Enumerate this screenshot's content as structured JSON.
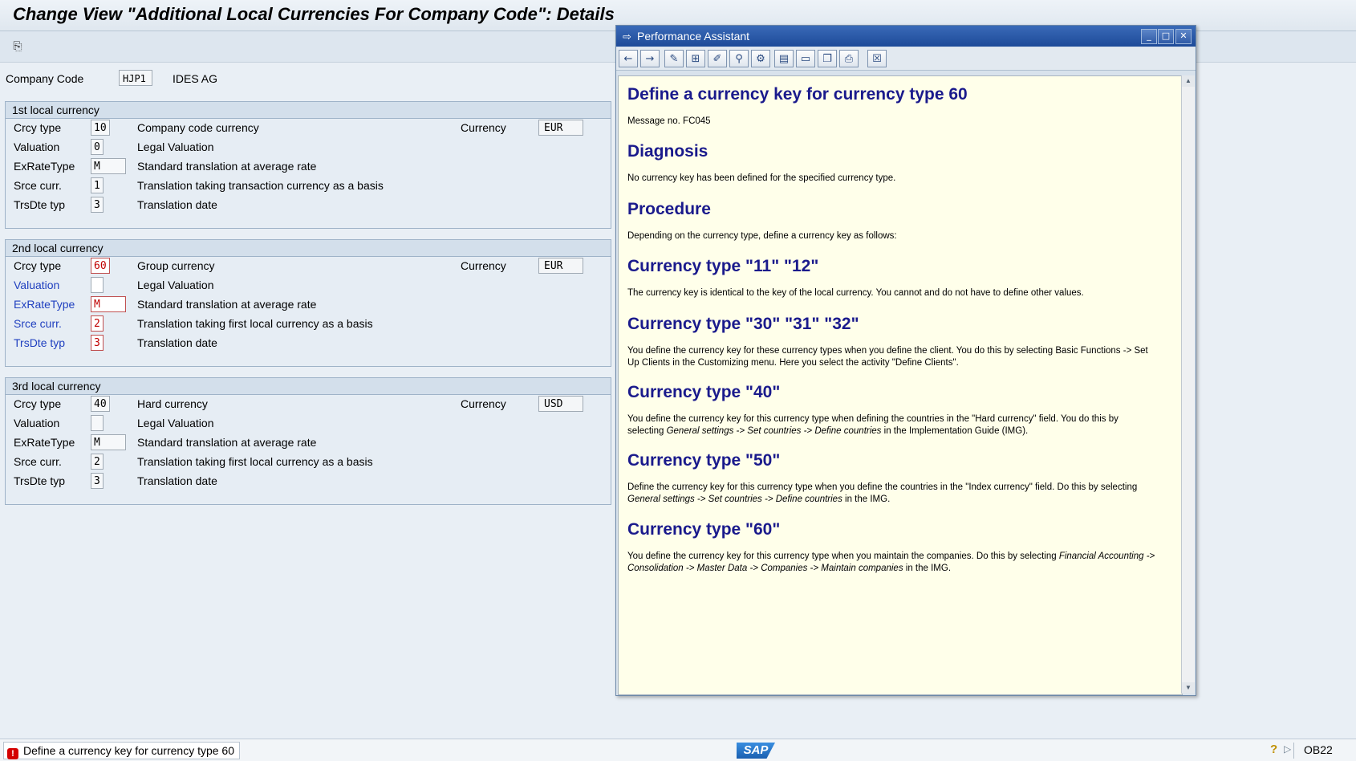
{
  "window": {
    "title": "Change View \"Additional Local Currencies For Company Code\": Details"
  },
  "company": {
    "label": "Company Code",
    "code": "HJP1",
    "name": "IDES AG"
  },
  "groups": [
    {
      "title": "1st local currency",
      "rows": [
        {
          "label": "Crcy type",
          "value": "10",
          "desc": "Company code currency",
          "currency_label": "Currency",
          "currency": "EUR"
        },
        {
          "label": "Valuation",
          "value": "0",
          "desc": "Legal Valuation"
        },
        {
          "label": "ExRateType",
          "value": "M",
          "desc": "Standard translation at average rate"
        },
        {
          "label": "Srce curr.",
          "value": "1",
          "desc": "Translation taking transaction currency as a basis"
        },
        {
          "label": "TrsDte typ",
          "value": "3",
          "desc": "Translation date"
        }
      ]
    },
    {
      "title": "2nd local currency",
      "rows": [
        {
          "label": "Crcy type",
          "value": "60",
          "desc": "Group currency",
          "currency_label": "Currency",
          "currency": "EUR"
        },
        {
          "label": "Valuation",
          "value": "",
          "desc": "Legal Valuation"
        },
        {
          "label": "ExRateType",
          "value": "M",
          "desc": "Standard translation at average rate"
        },
        {
          "label": "Srce curr.",
          "value": "2",
          "desc": "Translation taking first local currency as a basis"
        },
        {
          "label": "TrsDte typ",
          "value": "3",
          "desc": "Translation date"
        }
      ]
    },
    {
      "title": "3rd local currency",
      "rows": [
        {
          "label": "Crcy type",
          "value": "40",
          "desc": "Hard currency",
          "currency_label": "Currency",
          "currency": "USD"
        },
        {
          "label": "Valuation",
          "value": "",
          "desc": "Legal Valuation"
        },
        {
          "label": "ExRateType",
          "value": "M",
          "desc": "Standard translation at average rate"
        },
        {
          "label": "Srce curr.",
          "value": "2",
          "desc": "Translation taking first local currency as a basis"
        },
        {
          "label": "TrsDte typ",
          "value": "3",
          "desc": "Translation date"
        }
      ]
    }
  ],
  "status": {
    "message": "Define a currency key for currency type 60",
    "tcode": "OB22",
    "logo": "SAP"
  },
  "assistant": {
    "title": "Performance Assistant",
    "doc": {
      "h_title": "Define a currency key for currency type 60",
      "message_no": "Message no. FC045",
      "h_diagnosis": "Diagnosis",
      "p_diagnosis": "No currency key has been defined for the specified currency type.",
      "h_procedure": "Procedure",
      "p_procedure": "Depending on the currency type, define a currency key as follows:",
      "h_11_12": "Currency type \"11\" \"12\"",
      "p_11_12": "The currency key is identical to the key of the local currency. You cannot and do not have to define other values.",
      "h_30": "Currency type \"30\" \"31\" \"32\"",
      "p_30": "You define the currency key for these currency types when you define the client. You do this by selecting Basic Functions -> Set Up Clients in the Customizing menu. Here you select the activity \"Define Clients\".",
      "h_40": "Currency type \"40\"",
      "p_40_a": "You define the currency key for this currency type when defining the countries in the \"Hard currency\" field.  You do this by selecting ",
      "p_40_i": "General settings -> Set countries -> Define countries",
      "p_40_b": " in the Implementation Guide (IMG).",
      "h_50": "Currency type \"50\"",
      "p_50_a": "Define the currency key for this currency type when you define the countries in the \"Index currency\" field. Do this by selecting ",
      "p_50_i": "General settings -> Set countries -> Define countries",
      "p_50_b": " in the IMG.",
      "h_60": "Currency type \"60\"",
      "p_60_a": "You define the currency key for this currency type when you maintain the companies. Do this by selecting ",
      "p_60_i": "Financial Accounting -> Consolidation -> Master Data -> Companies -> Maintain companies",
      "p_60_b": " in the IMG."
    }
  }
}
